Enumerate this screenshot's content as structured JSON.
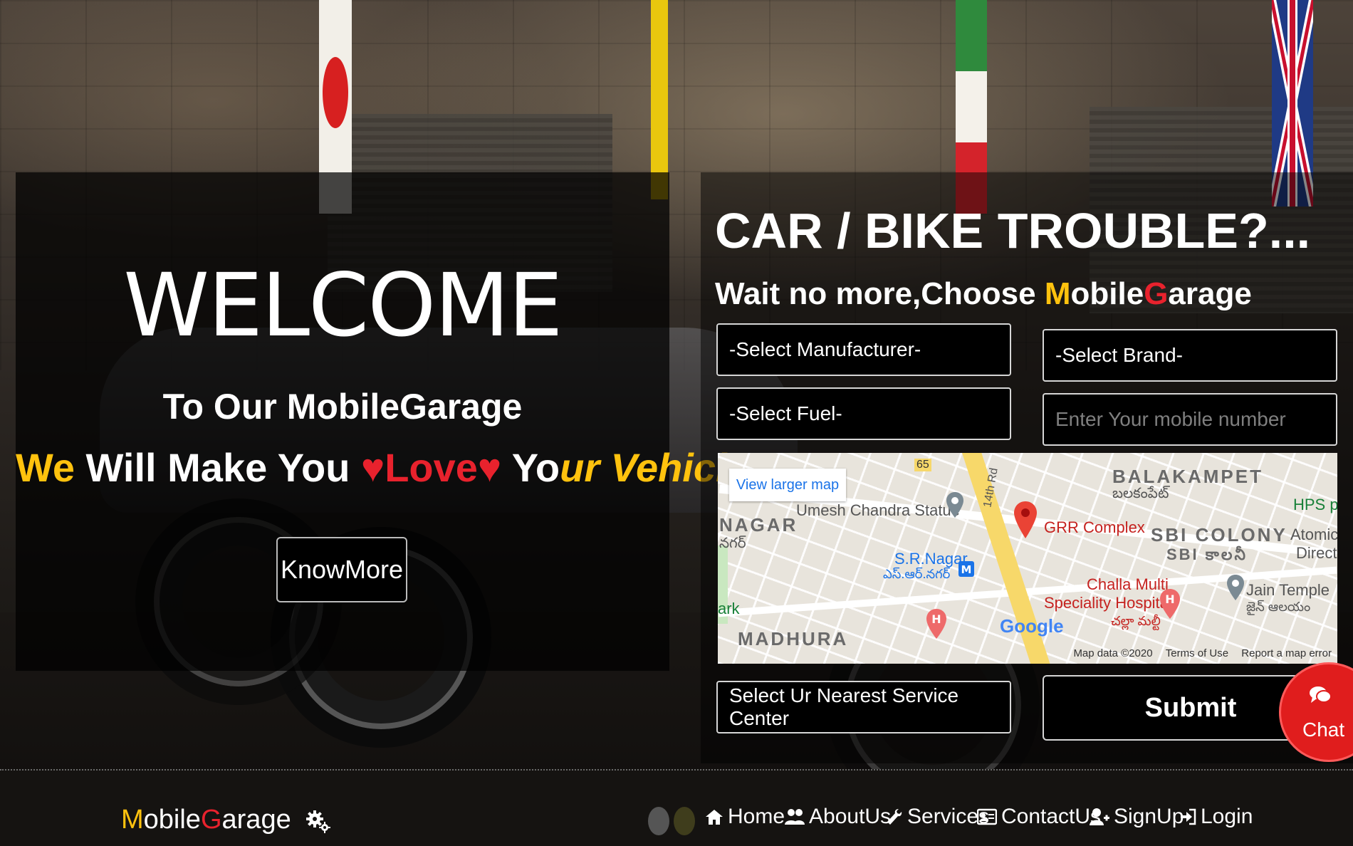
{
  "hero": {
    "welcome": "WELCOME",
    "subtitle": "To Our MobileGarage",
    "tagline": {
      "we": "We",
      "will_make_you": " Will Make You ",
      "heart1": "♥",
      "love": "Love",
      "heart2": "♥",
      "yo": " Yo",
      "ur": "ur ",
      "vehicle": "Vehicle"
    },
    "knowmore_label": "KnowMore"
  },
  "booking": {
    "headline": "CAR / BIKE TROUBLE?...",
    "subline_prefix": "Wait no more,Choose ",
    "brand_m": "M",
    "brand_obile": "obile",
    "brand_g": "G",
    "brand_arage": "arage",
    "manufacturer": "-Select Manufacturer-",
    "brand": "-Select Brand-",
    "fuel": "-Select Fuel-",
    "mobile_placeholder": "Enter Your mobile number",
    "service_center": "Select Ur Nearest Service Center",
    "submit_label": "Submit"
  },
  "map": {
    "larger_map": "View larger map",
    "labels": {
      "balakampet": "BALAKAMPET",
      "balakampet_te": "బలకంపేట్",
      "nagar": "NAGAR",
      "nagar_te": "నగర్",
      "umesh": "Umesh Chandra Statue",
      "grr": "GRR Complex",
      "sbi": "SBI COLONY",
      "sbi_te": "SBI కాలనీ",
      "hps": "HPS pl",
      "atomic": "Atomic",
      "directo": "Directo",
      "srnagar": "S.R.Nagar",
      "srnagar_te": "ఎస్.ఆర్.నగర్",
      "challa": "Challa Multi",
      "speciality": "Speciality Hospital",
      "challa_te": "చల్లా మల్టీ",
      "jain": "Jain Temple",
      "jain_te": "జైన్ ఆలయం",
      "madhura": "MADHURA",
      "ark": "ark",
      "road14": "14th Rd",
      "hwy": "65",
      "google": "Google"
    },
    "footer": {
      "data": "Map data ©2020",
      "terms": "Terms of Use",
      "report": "Report a map error"
    }
  },
  "chat": {
    "label": "Chat"
  },
  "nav": {
    "brand_m": "M",
    "brand_obile": "obile",
    "brand_g": "G",
    "brand_arage": "arage",
    "items": [
      {
        "label": "Home",
        "icon": "home-icon"
      },
      {
        "label": "AboutUs",
        "icon": "users-icon"
      },
      {
        "label": "Services",
        "icon": "wrench-icon"
      },
      {
        "label": "ContactUs",
        "icon": "address-card-icon"
      },
      {
        "label": "SignUp",
        "icon": "user-plus-icon"
      },
      {
        "label": "Login",
        "icon": "sign-in-icon"
      }
    ]
  },
  "colors": {
    "accent_yellow": "#ffc20e",
    "accent_red": "#e8222d",
    "chat_red": "#e01d1d"
  }
}
